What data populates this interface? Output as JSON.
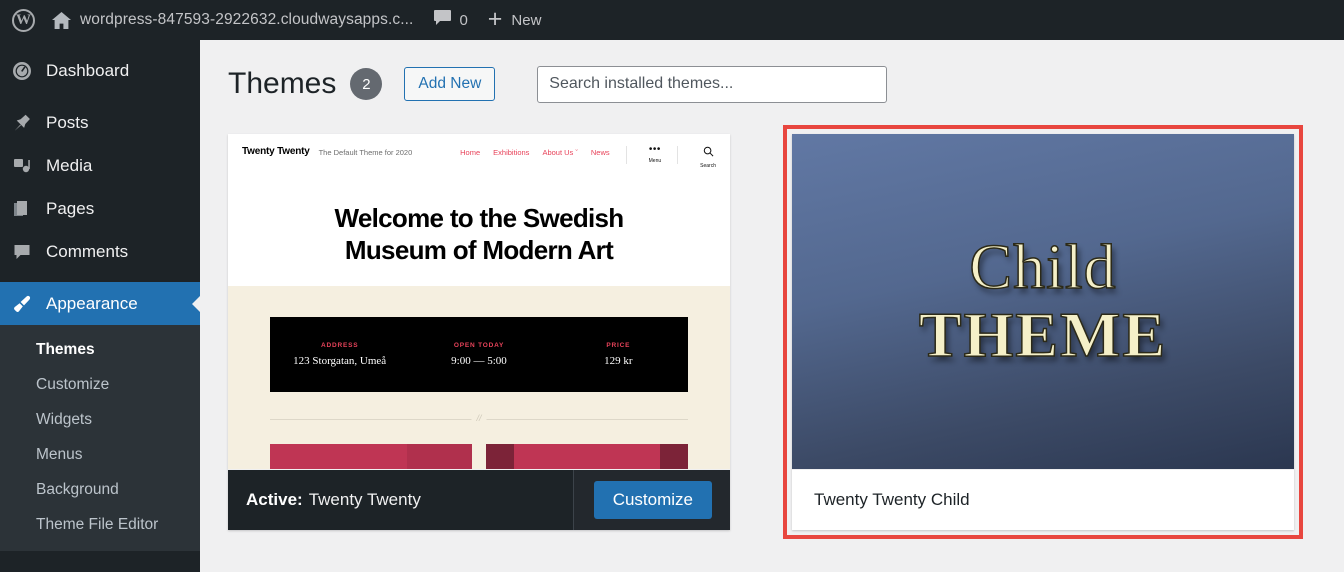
{
  "adminbar": {
    "wp_logo": "wordpress-logo-icon",
    "home_icon": "home-icon",
    "site_name": "wordpress-847593-2922632.cloudwaysapps.c...",
    "comment_icon": "comment-bubble-icon",
    "comment_count": "0",
    "plus_icon": "+",
    "new_label": "New"
  },
  "sidebar": {
    "items": [
      {
        "label": "Dashboard",
        "icon": "dashboard-icon"
      },
      {
        "label": "Posts",
        "icon": "pin-icon"
      },
      {
        "label": "Media",
        "icon": "media-icon"
      },
      {
        "label": "Pages",
        "icon": "pages-icon"
      },
      {
        "label": "Comments",
        "icon": "comment-bubble-icon"
      },
      {
        "label": "Appearance",
        "icon": "paintbrush-icon"
      }
    ],
    "submenu": [
      {
        "label": "Themes"
      },
      {
        "label": "Customize"
      },
      {
        "label": "Widgets"
      },
      {
        "label": "Menus"
      },
      {
        "label": "Background"
      },
      {
        "label": "Theme File Editor"
      }
    ]
  },
  "page": {
    "title": "Themes",
    "count": "2",
    "add_new_label": "Add New",
    "search_placeholder": "Search installed themes...",
    "search_value": ""
  },
  "themes": [
    {
      "name": "Twenty Twenty",
      "active_prefix": "Active:",
      "customize_label": "Customize",
      "preview": {
        "brand": "Twenty Twenty",
        "tagline": "The Default Theme for 2020",
        "nav": [
          "Home",
          "Exhibitions",
          "About Us ˇ",
          "News"
        ],
        "menu_glyph": "•••",
        "menu_label": "Menu",
        "search_glyph": "search-icon",
        "search_label": "Search",
        "headline_line1": "Welcome to the Swedish",
        "headline_line2": "Museum of Modern Art",
        "info": [
          {
            "key": "ADDRESS",
            "value": "123 Storgatan, Umeå"
          },
          {
            "key": "OPEN TODAY",
            "value": "9:00 — 5:00"
          },
          {
            "key": "PRICE",
            "value": "129 kr"
          }
        ],
        "separator_glyph": "//"
      }
    },
    {
      "name": "Twenty Twenty Child",
      "preview": {
        "word1": "Child",
        "word2": "THEME"
      }
    }
  ],
  "colors": {
    "admin_dark": "#1d2327",
    "submenu_dark": "#2c3338",
    "accent_blue": "#2271b1",
    "highlight_red": "#e8463f",
    "page_bg": "#f0f0f1",
    "theme_pink": "#e8435a",
    "theme_crimson": "#bf3554"
  }
}
